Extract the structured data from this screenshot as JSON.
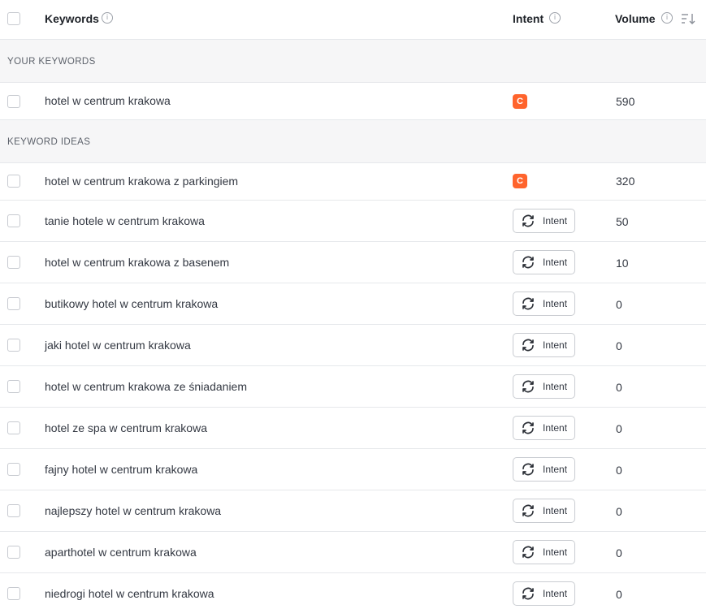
{
  "header": {
    "keywords_label": "Keywords",
    "intent_label": "Intent",
    "volume_label": "Volume",
    "info_glyph": "i"
  },
  "sections": {
    "your_keywords": "YOUR KEYWORDS",
    "keyword_ideas": "KEYWORD IDEAS"
  },
  "your_keywords": [
    {
      "keyword": "hotel w centrum krakowa",
      "intent_badge": "C",
      "volume": "590"
    }
  ],
  "keyword_ideas": [
    {
      "keyword": "hotel w centrum krakowa z parkingiem",
      "intent_badge": "C",
      "volume": "320"
    },
    {
      "keyword": "tanie hotele w centrum krakowa",
      "intent_button": "Intent",
      "volume": "50"
    },
    {
      "keyword": "hotel w centrum krakowa z basenem",
      "intent_button": "Intent",
      "volume": "10"
    },
    {
      "keyword": "butikowy hotel w centrum krakowa",
      "intent_button": "Intent",
      "volume": "0"
    },
    {
      "keyword": "jaki hotel w centrum krakowa",
      "intent_button": "Intent",
      "volume": "0"
    },
    {
      "keyword": "hotel w centrum krakowa ze śniadaniem",
      "intent_button": "Intent",
      "volume": "0"
    },
    {
      "keyword": "hotel ze spa w centrum krakowa",
      "intent_button": "Intent",
      "volume": "0"
    },
    {
      "keyword": "fajny hotel w centrum krakowa",
      "intent_button": "Intent",
      "volume": "0"
    },
    {
      "keyword": "najlepszy hotel w centrum krakowa",
      "intent_button": "Intent",
      "volume": "0"
    },
    {
      "keyword": "aparthotel w centrum krakowa",
      "intent_button": "Intent",
      "volume": "0"
    },
    {
      "keyword": "niedrogi hotel w centrum krakowa",
      "intent_button": "Intent",
      "volume": "0"
    }
  ],
  "colors": {
    "commercial_badge": "#ff642d",
    "section_bg": "#f6f6f7",
    "divider": "#e6e8eb"
  },
  "icons": [
    "info-icon",
    "sort-icon",
    "refresh-icon",
    "checkbox"
  ]
}
